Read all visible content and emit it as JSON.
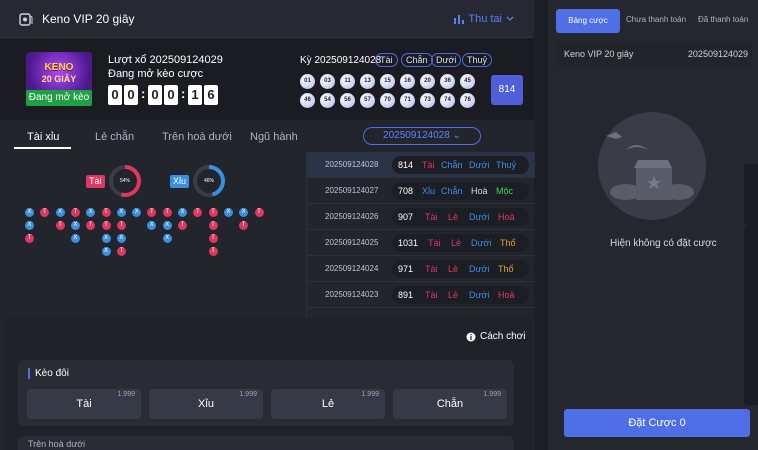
{
  "header": {
    "title": "Keno VIP 20 giây",
    "thu_tai": "Thu tai"
  },
  "draw": {
    "promo_line1": "KENO",
    "promo_line2": "20 GIÂY",
    "promo_button": "Đang mở kèo",
    "round_label": "Lượt xổ 202509124029",
    "status": "Đang mở kèo cược",
    "countdown": [
      "0",
      "0",
      "0",
      "0",
      "1",
      "6"
    ],
    "ky_label": "Kỳ 202509124028",
    "tags": [
      "Tài",
      "Chẵn",
      "Dưới",
      "Thuỷ"
    ],
    "balls": [
      "01",
      "03",
      "11",
      "13",
      "15",
      "16",
      "20",
      "36",
      "45",
      "46",
      "54",
      "56",
      "57",
      "70",
      "71",
      "73",
      "74",
      "76"
    ],
    "result": "814"
  },
  "tabs": [
    "Tài xỉu",
    "Lẻ chẵn",
    "Trên hoà dưới",
    "Ngũ hành"
  ],
  "period_select": "202509124028",
  "stats": {
    "tai_label": "Tài",
    "xiu_label": "Xỉu",
    "tai_percent": "54%",
    "xiu_percent": "46%",
    "tai_value": 0.54,
    "xiu_value": 0.46
  },
  "history": [
    {
      "id": "202509124028",
      "val": "814",
      "tags": [
        "Tài",
        "Chẵn",
        "Dưới",
        "Thuỷ"
      ]
    },
    {
      "id": "202509124027",
      "val": "708",
      "tags": [
        "Xỉu",
        "Chẵn",
        "Hoà",
        "Mộc"
      ]
    },
    {
      "id": "202509124026",
      "val": "907",
      "tags": [
        "Tài",
        "Lẻ",
        "Dưới",
        "Hoả"
      ]
    },
    {
      "id": "202509124025",
      "val": "1031",
      "tags": [
        "Tài",
        "Lẻ",
        "Dưới",
        "Thổ"
      ]
    },
    {
      "id": "202509124024",
      "val": "971",
      "tags": [
        "Tài",
        "Lẻ",
        "Dưới",
        "Thổ"
      ]
    },
    {
      "id": "202509124023",
      "val": "891",
      "tags": [
        "Tài",
        "Lẻ",
        "Dưới",
        "Hoả"
      ]
    }
  ],
  "how_to_play": "Cách chơi",
  "keo_doi": {
    "title": "Kèo đôi",
    "options": [
      {
        "name": "Tài",
        "odds": "1.999"
      },
      {
        "name": "Xỉu",
        "odds": "1.999"
      },
      {
        "name": "Lẻ",
        "odds": "1.999"
      },
      {
        "name": "Chẵn",
        "odds": "1.999"
      }
    ]
  },
  "tren_hoa_duoi": "Trên hoà dưới",
  "right": {
    "tabs": [
      "Bảng cược",
      "Chưa thanh toán",
      "Đã thanh toán"
    ],
    "game": "Keno VIP 20 giây",
    "period": "202509124029",
    "empty_text": "Hiện không có đặt cược",
    "bet_button": "Đặt Cược 0"
  },
  "colors": {
    "accent": "#4f6ee6",
    "tai": "#e0365f",
    "xiu": "#3a8fe0",
    "green": "#1fa044"
  },
  "road": [
    [
      "X",
      "X",
      "T"
    ],
    [
      "T"
    ],
    [
      "X",
      "T"
    ],
    [
      "T",
      "X",
      "X"
    ],
    [
      "X",
      "T"
    ],
    [
      "T",
      "T",
      "X",
      "X"
    ],
    [
      "X",
      "T",
      "X",
      "T"
    ],
    [
      "X"
    ],
    [
      "T",
      "X"
    ],
    [
      "T",
      "X",
      "X"
    ],
    [
      "X",
      "T"
    ],
    [
      "T"
    ],
    [
      "T",
      "T",
      "T",
      "T"
    ],
    [
      "X"
    ],
    [
      "X",
      "T"
    ],
    [
      "T"
    ]
  ]
}
